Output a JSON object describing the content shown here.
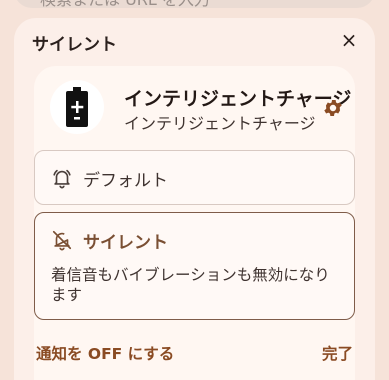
{
  "background_search": {
    "text": "検索または URL を入力"
  },
  "sheet": {
    "title": "サイレント",
    "close_label": "×"
  },
  "app": {
    "name": "インテリジェントチャージ",
    "subtitle": "インテリジェントチャージ",
    "icon": "battery-charging-icon",
    "settings_icon": "gear-icon"
  },
  "options": {
    "default": {
      "label": "デフォルト",
      "icon": "bell-icon"
    },
    "silent": {
      "label": "サイレント",
      "icon": "bell-off-icon",
      "description": "着信音もバイブレーションも無効になります",
      "selected": true
    }
  },
  "footer": {
    "turn_off_label": "通知を OFF にする",
    "done_label": "完了"
  },
  "colors": {
    "accent": "#8a4b23",
    "selected_border": "#7f5c49",
    "background": "#f6e3d9"
  }
}
